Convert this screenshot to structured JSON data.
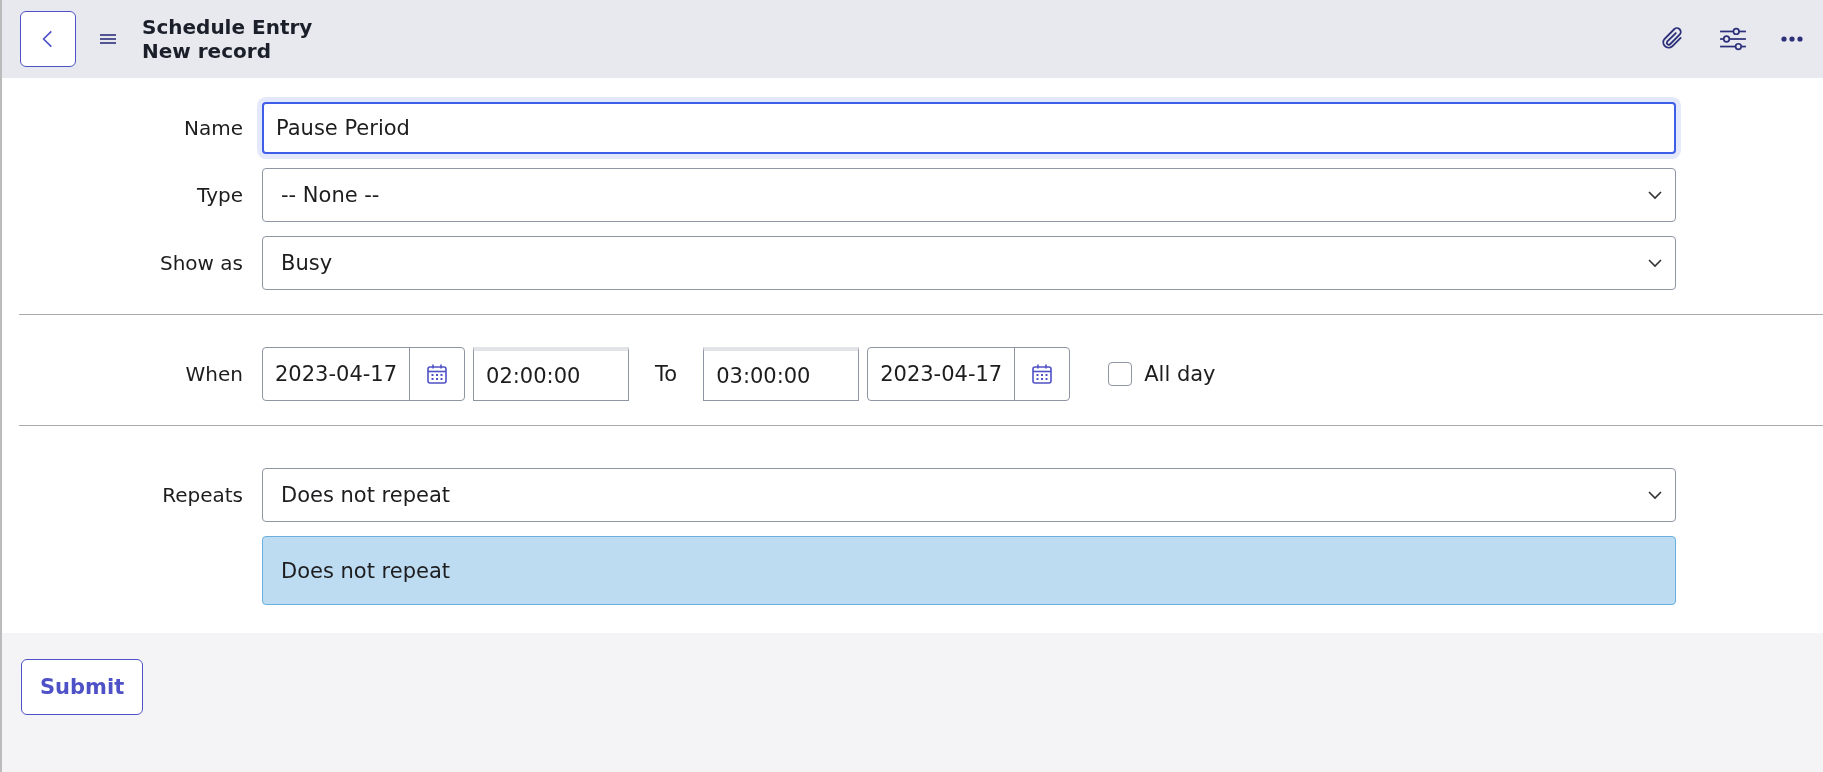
{
  "header": {
    "title": "Schedule Entry",
    "subtitle": "New record"
  },
  "fields": [
    {
      "kind": "text",
      "label": "Name",
      "value": "Pause Period",
      "focused": true
    },
    {
      "kind": "select",
      "label": "Type",
      "value": "-- None --"
    },
    {
      "kind": "select",
      "label": "Show as",
      "value": "Busy"
    }
  ],
  "when": {
    "label": "When",
    "start_date": "2023-04-17",
    "start_time": "02:00:00",
    "to_label": "To",
    "end_time": "03:00:00",
    "end_date": "2023-04-17",
    "all_day": {
      "label": "All day",
      "checked": false
    }
  },
  "repeats": {
    "label": "Repeats",
    "value": "Does not repeat",
    "summary": "Does not repeat"
  },
  "buttons": [
    "Submit"
  ]
}
